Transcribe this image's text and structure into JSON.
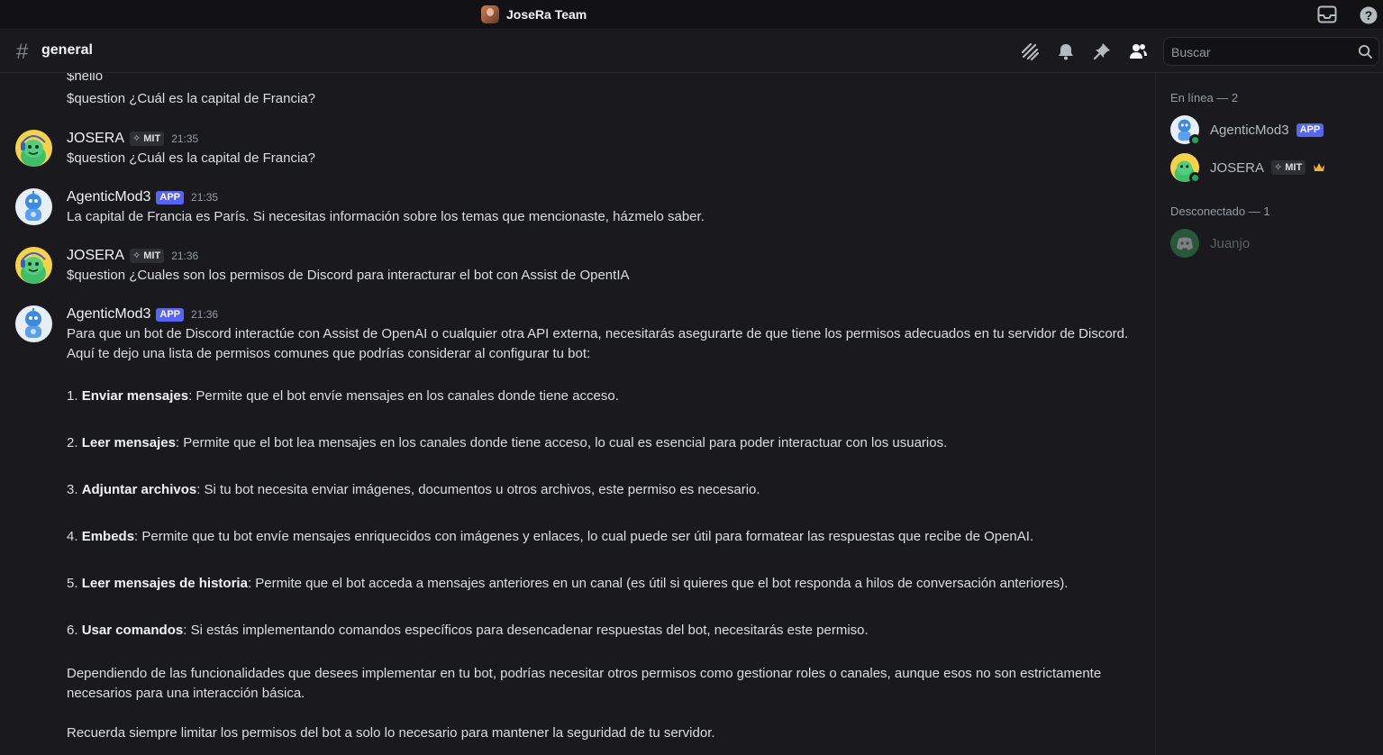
{
  "titlebar": {
    "server_name": "JoseRa Team",
    "icons": [
      "inbox-icon",
      "help-icon"
    ]
  },
  "header": {
    "channel_name": "general",
    "icons": [
      "threads-icon",
      "notification-bell-icon",
      "pin-icon",
      "members-icon"
    ],
    "search_placeholder": "Buscar"
  },
  "chat": {
    "continuation": [
      "$hello",
      "$question ¿Cuál es la capital de Francia?"
    ],
    "messages": [
      {
        "author": "JOSERA",
        "tag": "MIT",
        "time": "21:35",
        "text": "$question ¿Cuál es la capital de Francia?"
      },
      {
        "author": "AgenticMod3",
        "tag": "APP",
        "time": "21:35",
        "text": "La capital de Francia es París. Si necesitas información sobre los temas que mencionaste, házmelo saber."
      },
      {
        "author": "JOSERA",
        "tag": "MIT",
        "time": "21:36",
        "text": "$question ¿Cuales son los permisos de Discord para interacturar el bot con Assist de OpentIA"
      },
      {
        "author": "AgenticMod3",
        "tag": "APP",
        "time": "21:36",
        "intro": "Para que un bot de Discord interactúe con Assist de OpenAI o cualquier otra API externa, necesitarás asegurarte de que tiene los permisos adecuados en tu servidor de Discord. Aquí te dejo una lista de permisos comunes que podrías considerar al configurar tu bot:",
        "items": [
          {
            "num": "1. ",
            "title": "Enviar mensajes",
            "text": ": Permite que el bot envíe mensajes en los canales donde tiene acceso."
          },
          {
            "num": "2. ",
            "title": "Leer mensajes",
            "text": ": Permite que el bot lea mensajes en los canales donde tiene acceso, lo cual es esencial para poder interactuar con los usuarios."
          },
          {
            "num": "3. ",
            "title": "Adjuntar archivos",
            "text": ": Si tu bot necesita enviar imágenes, documentos u otros archivos, este permiso es necesario."
          },
          {
            "num": "4. ",
            "title": "Embeds",
            "text": ": Permite que tu bot envíe mensajes enriquecidos con imágenes y enlaces, lo cual puede ser útil para formatear las respuestas que recibe de OpenAI."
          },
          {
            "num": "5. ",
            "title": "Leer mensajes de historia",
            "text": ": Permite que el bot acceda a mensajes anteriores en un canal (es útil si quieres que el bot responda a hilos de conversación anteriores)."
          },
          {
            "num": "6. ",
            "title": "Usar comandos",
            "text": ": Si estás implementando comandos específicos para desencadenar respuestas del bot, necesitarás este permiso."
          }
        ],
        "outro1": "Dependiendo de las funcionalidades que desees implementar en tu bot, podrías necesitar otros permisos como gestionar roles o canales, aunque esos no son estrictamente necesarios para una interacción básica.",
        "outro2": "Recuerda siempre limitar los permisos del bot a solo lo necesario para mantener la seguridad de tu servidor."
      }
    ]
  },
  "members": {
    "online_header": "En línea — 2",
    "offline_header": "Desconectado — 1",
    "online": [
      {
        "name": "AgenticMod3",
        "tag": "APP"
      },
      {
        "name": "JOSERA",
        "tag": "MIT",
        "crown": "owner-crown-icon"
      }
    ],
    "offline": [
      {
        "name": "Juanjo"
      }
    ]
  },
  "colors": {
    "background": "#1a1a1e",
    "app_tag": "#5865f2",
    "online": "#23a55a",
    "crown": "#f0b232"
  }
}
